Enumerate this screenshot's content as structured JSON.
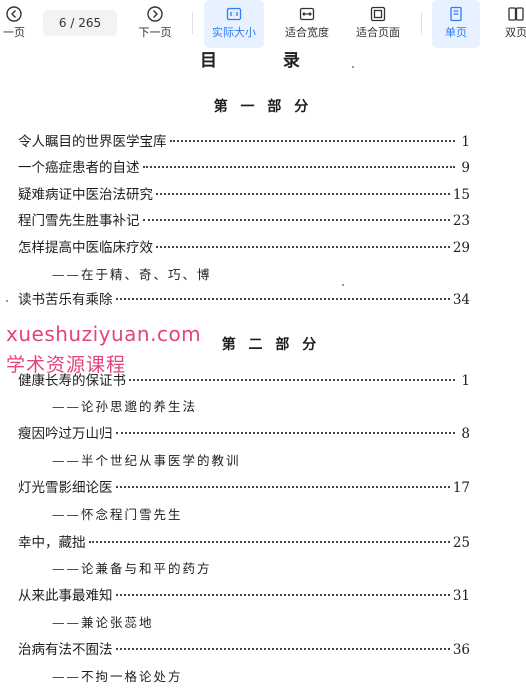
{
  "toolbar": {
    "prev_page": "一页",
    "page_indicator": "6 / 265",
    "next_page": "下一页",
    "actual_size": "实际大小",
    "fit_width": "适合宽度",
    "fit_page": "适合页面",
    "single_page": "单页",
    "double_page": "双页"
  },
  "document": {
    "heading": "目 录",
    "part1": {
      "title": "第 一 部 分",
      "entries": [
        {
          "title": "令人瞩目的世界医学宝库",
          "page": "1"
        },
        {
          "title": "一个癌症患者的自述",
          "page": "9"
        },
        {
          "title": "疑难病证中医治法研究",
          "page": "15"
        },
        {
          "title": "程门雪先生胜事补记",
          "page": "23"
        },
        {
          "title": "怎样提高中医临床疗效",
          "page": "29",
          "sub": "——在于精、奇、巧、博"
        },
        {
          "title": "读书苦乐有乘除",
          "page": "34"
        }
      ]
    },
    "part2": {
      "title": "第 二 部 分",
      "entries": [
        {
          "title": "健康长寿的保证书",
          "page": "1",
          "sub": "——论孙思邈的养生法"
        },
        {
          "title": "瘦因吟过万山归",
          "page": "8",
          "sub": "——半个世纪从事医学的教训"
        },
        {
          "title": "灯光雪影细论医",
          "page": "17",
          "sub": "——怀念程门雪先生"
        },
        {
          "title": "幸中，藏拙",
          "page": "25",
          "sub": "——论兼备与和平的药方"
        },
        {
          "title": "从来此事最难知",
          "page": "31",
          "sub": "——兼论张蕊地"
        },
        {
          "title": "治病有法不囿法",
          "page": "36",
          "sub": "——不拘一格论处方"
        }
      ]
    }
  },
  "watermark": {
    "line1": "xueshuziyuan.com",
    "line2": "学术资源课程",
    "color": "#e0226b"
  },
  "colors": {
    "accent": "#2b7cf6",
    "active_bg": "#e8f1ff"
  }
}
